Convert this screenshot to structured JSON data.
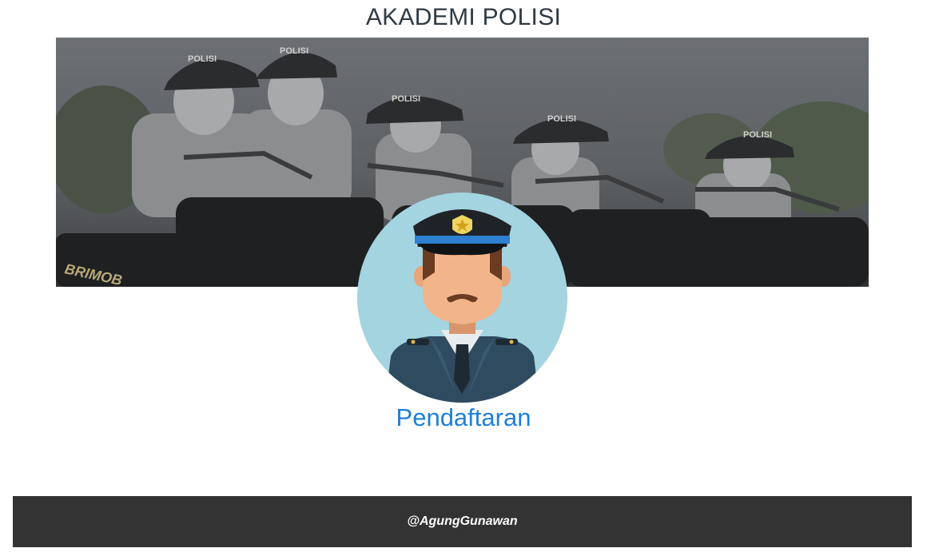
{
  "header": {
    "title": "AKADEMI POLISI"
  },
  "banner": {
    "image": "police-officers-on-motorcycles-photo",
    "helmet_text": "POLISI",
    "bike_text": "BRIMOB",
    "tint_color": "#5b5d60"
  },
  "avatar": {
    "icon": "police-officer-avatar-icon",
    "circle_color": "#a3d4e0",
    "uniform_color": "#2f4b5f"
  },
  "main": {
    "register_link": "Pendaftaran",
    "link_color": "#1e7fd8"
  },
  "footer": {
    "credit": "@AgungGunawan",
    "background": "#333333"
  }
}
